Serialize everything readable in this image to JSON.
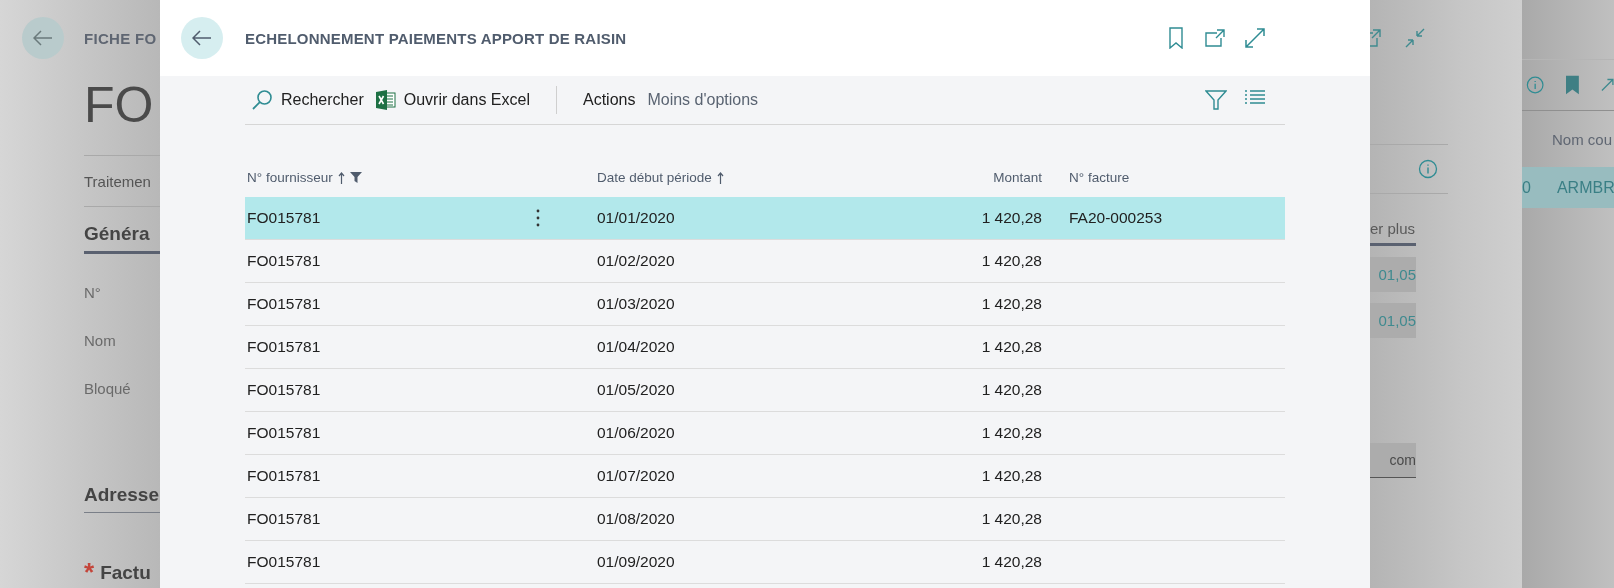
{
  "background_page": {
    "title": "FICHE FO",
    "heading": "FO",
    "action_tab": "Traitemen",
    "section": "Généra",
    "fields": [
      {
        "label": "N°"
      },
      {
        "label": "Nom"
      },
      {
        "label": "Bloqué"
      }
    ],
    "section_2": "Adresse",
    "required_mark": "*",
    "required_field": "Factu"
  },
  "background_side": {
    "link": "er plus",
    "values": [
      "01,05",
      "01,05"
    ],
    "email_field": "com"
  },
  "background_list": {
    "column": "Nom cou",
    "row": {
      "cells": [
        "0",
        "ARMBR"
      ],
      "selected": true
    }
  },
  "dialog": {
    "title": "ECHELONNEMENT PAIEMENTS APPORT DE RAISIN",
    "toolbar": [
      {
        "kind": "search",
        "label": "Rechercher"
      },
      {
        "kind": "excel",
        "label": "Ouvrir dans Excel"
      },
      {
        "kind": "menu",
        "label": "Actions"
      },
      {
        "kind": "more",
        "label": "Moins d'options"
      }
    ],
    "columns": [
      {
        "label": "N° fournisseur",
        "sorted": true,
        "filtered": true,
        "kind": "text"
      },
      {
        "label": "Date début période",
        "sorted": true,
        "filtered": false,
        "kind": "text"
      },
      {
        "label": "Montant",
        "sorted": false,
        "filtered": false,
        "kind": "amount"
      },
      {
        "label": "N° facture",
        "sorted": false,
        "filtered": false,
        "kind": "text"
      }
    ],
    "rows": [
      {
        "cells": [
          "FO015781",
          "01/01/2020",
          "1 420,28",
          "FA20-000253"
        ],
        "selected": true
      },
      {
        "cells": [
          "FO015781",
          "01/02/2020",
          "1 420,28"
        ],
        "selected": false
      },
      {
        "cells": [
          "FO015781",
          "01/03/2020",
          "1 420,28"
        ],
        "selected": false
      },
      {
        "cells": [
          "FO015781",
          "01/04/2020",
          "1 420,28"
        ],
        "selected": false
      },
      {
        "cells": [
          "FO015781",
          "01/05/2020",
          "1 420,28"
        ],
        "selected": false
      },
      {
        "cells": [
          "FO015781",
          "01/06/2020",
          "1 420,28"
        ],
        "selected": false
      },
      {
        "cells": [
          "FO015781",
          "01/07/2020",
          "1 420,28"
        ],
        "selected": false
      },
      {
        "cells": [
          "FO015781",
          "01/08/2020",
          "1 420,28"
        ],
        "selected": false
      },
      {
        "cells": [
          "FO015781",
          "01/09/2020",
          "1 420,28"
        ],
        "selected": false
      }
    ]
  }
}
